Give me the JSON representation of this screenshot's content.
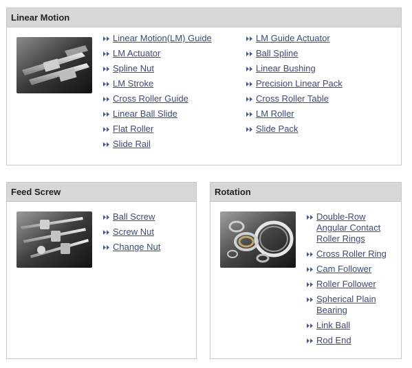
{
  "linear_motion": {
    "title": "Linear Motion",
    "left_links": [
      "Linear Motion(LM) Guide",
      "LM Actuator",
      "Spline Nut",
      "LM Stroke",
      "Cross Roller Guide",
      "Linear Ball Slide",
      "Flat Roller",
      "Slide Rail"
    ],
    "right_links": [
      "LM Guide Actuator",
      "Ball Spline",
      "Linear Bushing",
      "Precision Linear Pack",
      "Cross Roller Table",
      "LM Roller",
      "Slide Pack"
    ]
  },
  "feed_screw": {
    "title": "Feed Screw",
    "links": [
      "Ball Screw",
      "Screw Nut",
      "Change Nut"
    ]
  },
  "rotation": {
    "title": "Rotation",
    "links": [
      "Double-Row Angular Contact Roller Rings",
      "Cross Roller Ring",
      "Cam Follower",
      "Roller Follower",
      "Spherical Plain Bearing",
      "Link Ball",
      "Rod End"
    ]
  },
  "colors": {
    "link": "#3d4a7a",
    "bullet": "#4a5a8a",
    "header_bg": "#d7d7d7",
    "border": "#c9c9c9"
  },
  "icons": {
    "bullet": "double-chevron-right-icon"
  }
}
